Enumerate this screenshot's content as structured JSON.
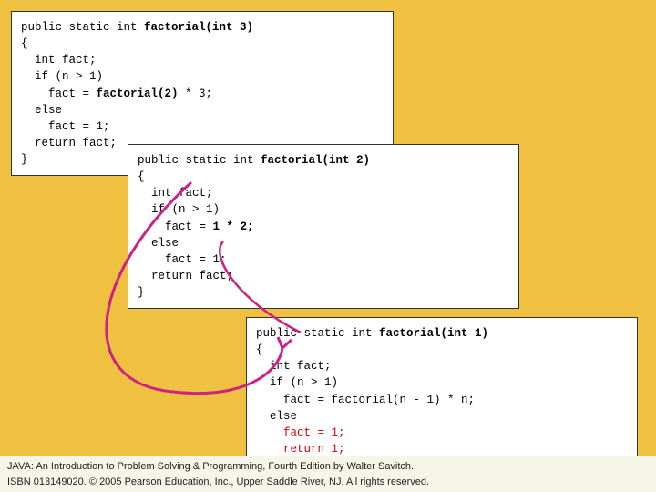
{
  "box1": {
    "label": "code-box-1",
    "lines": [
      {
        "text": "public static int ",
        "bold_part": "factorial(int 3)"
      },
      {
        "text": "{",
        "bold_part": ""
      },
      {
        "text": "  int fact;",
        "bold_part": ""
      },
      {
        "text": "  if (n > 1)",
        "bold_part": ""
      },
      {
        "text": "    fact = ",
        "bold_part": "",
        "highlight": "factorial(2) * 3;"
      },
      {
        "text": "  else",
        "bold_part": ""
      },
      {
        "text": "    fact = 1;",
        "bold_part": ""
      },
      {
        "text": "  return fact;",
        "bold_part": ""
      },
      {
        "text": "}",
        "bold_part": ""
      }
    ]
  },
  "box2": {
    "label": "code-box-2",
    "lines": [
      {
        "text": "public static int ",
        "bold_part": "factorial(int 2)"
      },
      {
        "text": "{",
        "bold_part": ""
      },
      {
        "text": "  int fact;",
        "bold_part": ""
      },
      {
        "text": "  if (n > 1)",
        "bold_part": ""
      },
      {
        "text": "    fact = ",
        "bold_part": "",
        "highlight": "1 * 2;"
      },
      {
        "text": "  else",
        "bold_part": ""
      },
      {
        "text": "    fact = 1;",
        "bold_part": ""
      },
      {
        "text": "  return fact;",
        "bold_part": ""
      },
      {
        "text": "}",
        "bold_part": ""
      }
    ]
  },
  "box3": {
    "label": "code-box-3",
    "lines": [
      {
        "text": "public static int ",
        "bold_part": "factorial(int 1)"
      },
      {
        "text": "{",
        "bold_part": ""
      },
      {
        "text": "  int fact;",
        "bold_part": ""
      },
      {
        "text": "  if (n > 1)",
        "bold_part": ""
      },
      {
        "text": "    fact = factorial(n - 1) * n;",
        "bold_part": ""
      },
      {
        "text": "  else",
        "bold_part": ""
      },
      {
        "text": "    ",
        "bold_part": "",
        "red_part": "fact = 1;"
      },
      {
        "text": "    ",
        "bold_part": "",
        "red_part": "return 1;"
      }
    ]
  },
  "footer": {
    "line1": "JAVA: An Introduction to Problem Solving & Programming, Fourth Edition by Walter Savitch.",
    "line2": "ISBN 013149020.  © 2005 Pearson Education, Inc., Upper Saddle River, NJ. All rights reserved."
  }
}
